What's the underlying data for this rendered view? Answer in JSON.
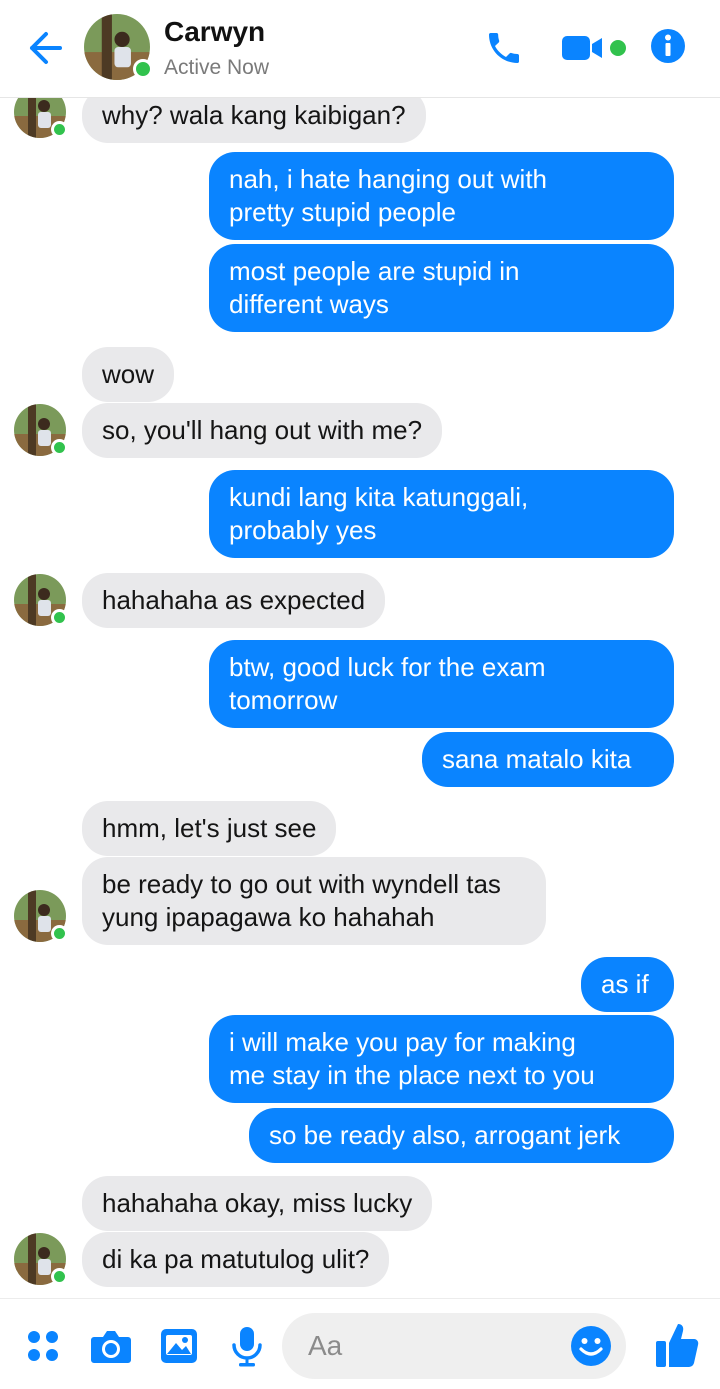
{
  "header": {
    "contact_name": "Carwyn",
    "status": "Active Now"
  },
  "colors": {
    "accent": "#0a84ff",
    "incoming_bubble": "#e9e9eb",
    "online": "#31c24d"
  },
  "messages": [
    {
      "side": "in",
      "text": "why? wala kang kaibigan?"
    },
    {
      "side": "out",
      "text": "nah, i hate hanging out with\npretty stupid people"
    },
    {
      "side": "out",
      "text": "most people are stupid in\ndifferent ways"
    },
    {
      "side": "in",
      "text": "wow"
    },
    {
      "side": "in",
      "text": "so, you'll hang out with me?"
    },
    {
      "side": "out",
      "text": "kundi lang kita katunggali,\nprobably yes"
    },
    {
      "side": "in",
      "text": "hahahaha as expected"
    },
    {
      "side": "out",
      "text": "btw, good luck for the exam\ntomorrow"
    },
    {
      "side": "out",
      "text": "sana matalo kita"
    },
    {
      "side": "in",
      "text": "hmm, let's just see"
    },
    {
      "side": "in",
      "text": "be ready to go out with wyndell tas\nyung ipapagawa ko hahahah"
    },
    {
      "side": "out",
      "text": "as if"
    },
    {
      "side": "out",
      "text": "i will make you pay for making\nme stay in the place next to you"
    },
    {
      "side": "out",
      "text": "so be ready also, arrogant jerk"
    },
    {
      "side": "in",
      "text": "hahahaha okay, miss lucky"
    },
    {
      "side": "in",
      "text": "di ka pa matutulog ulit?"
    }
  ],
  "composer": {
    "placeholder": "Aa",
    "icons": [
      "menu-dots-icon",
      "camera-icon",
      "gallery-icon",
      "microphone-icon",
      "emoji-icon",
      "thumbs-up-icon"
    ]
  }
}
